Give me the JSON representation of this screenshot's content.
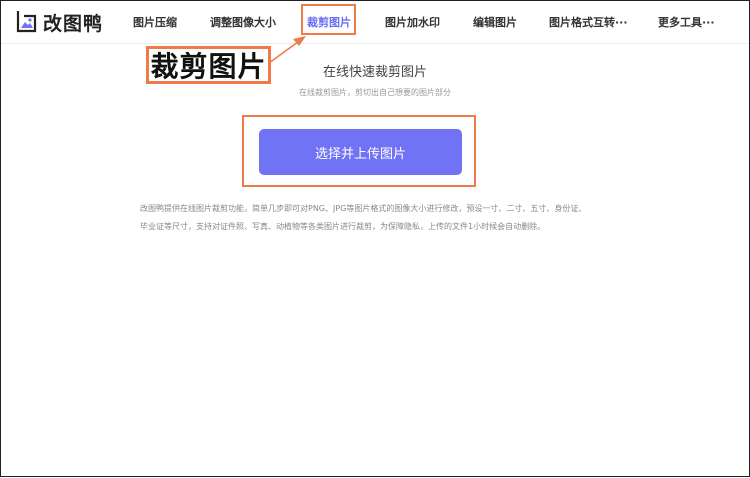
{
  "app": {
    "logo_text": "改图鸭"
  },
  "nav": {
    "items": [
      {
        "label": "图片压缩"
      },
      {
        "label": "调整图像大小"
      },
      {
        "label": "裁剪图片",
        "active": true
      },
      {
        "label": "图片加水印"
      },
      {
        "label": "编辑图片"
      },
      {
        "label": "图片格式互转···"
      },
      {
        "label": "更多工具···"
      }
    ]
  },
  "annotation": {
    "label": "裁剪图片"
  },
  "main": {
    "title": "在线快速裁剪图片",
    "subtitle": "在线裁剪图片，剪切出自己想要的图片部分",
    "upload_button": "选择并上传图片",
    "description": "改图鸭提供在线图片裁剪功能，简单几步即可对PNG、JPG等图片格式的图像大小进行修改，预设一寸、二寸、五寸、身份证、毕业证等尺寸，支持对证件照、写真、动植物等各类图片进行裁剪，为保障隐私，上传的文件1小时候会自动删除。"
  },
  "colors": {
    "accent": "#6f73f4",
    "active_nav": "#6a6ef5",
    "annotation": "#ef7a4a"
  }
}
